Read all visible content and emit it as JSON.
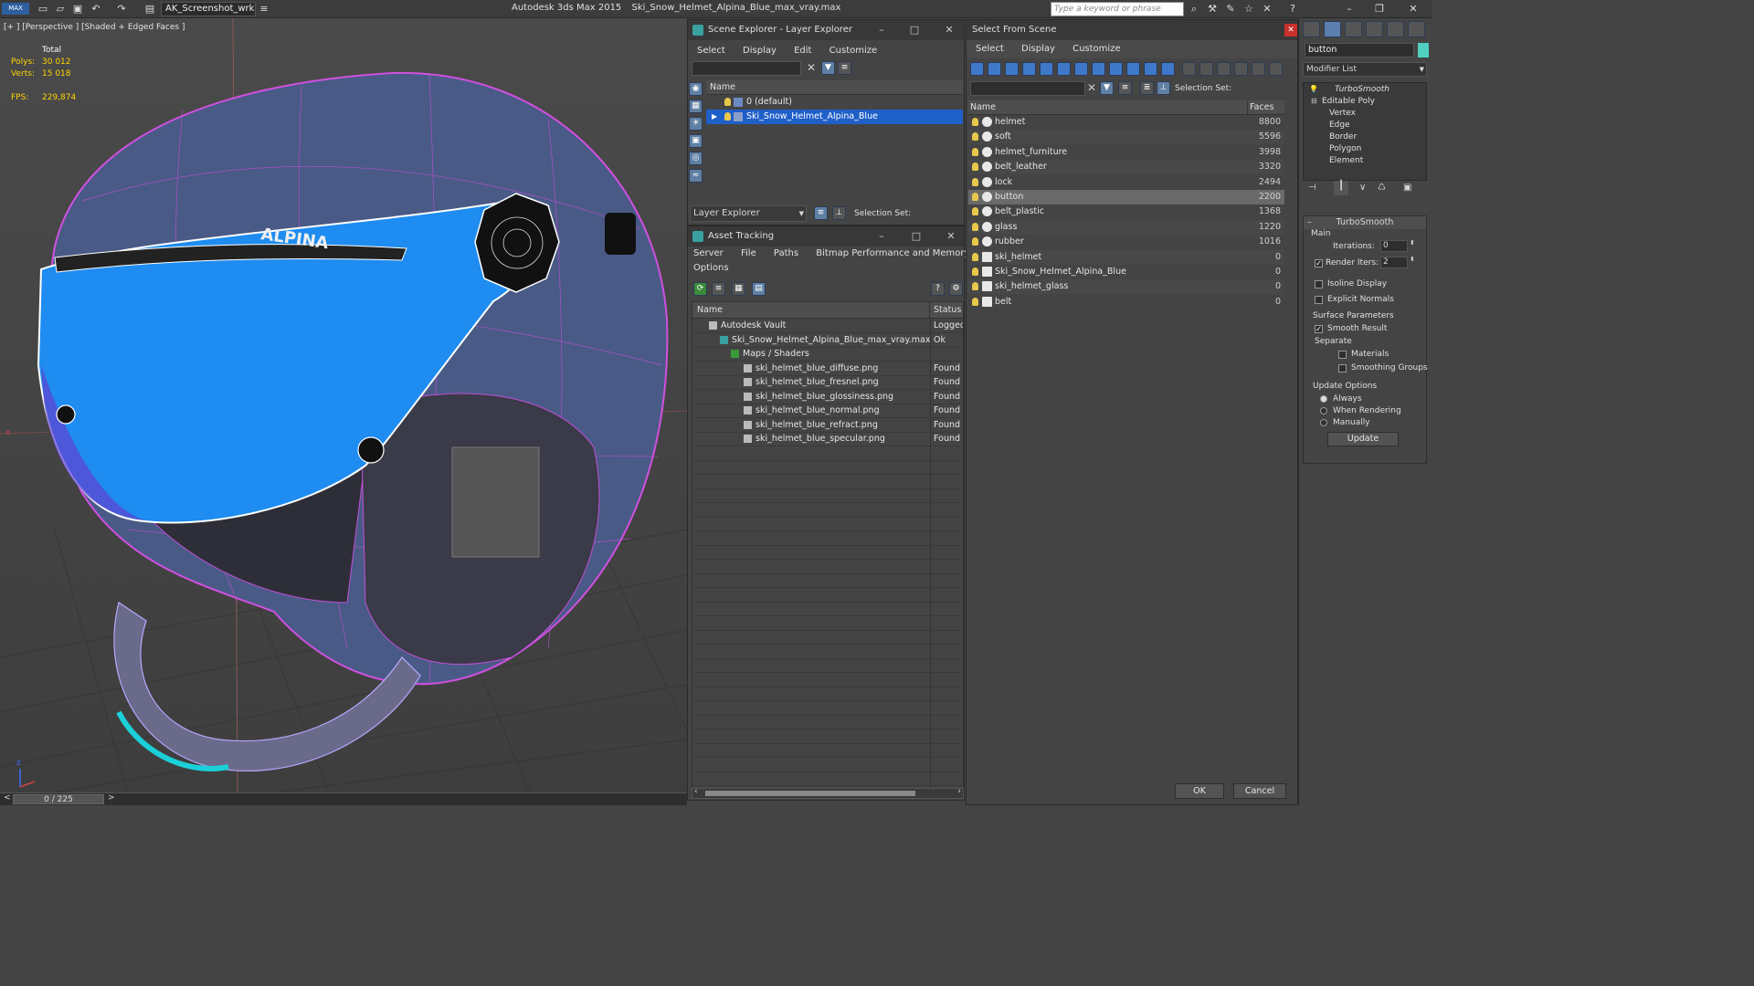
{
  "titlebar": {
    "app_badge": "MAX",
    "workspace": "AK_Screenshot_wrksp",
    "app_name": "Autodesk 3ds Max  2015",
    "file_name": "Ski_Snow_Helmet_Alpina_Blue_max_vray.max",
    "search_placeholder": "Type a keyword or phrase",
    "icons": [
      "new-icon",
      "open-icon",
      "save-icon",
      "undo-icon",
      "redo-icon",
      "project-icon",
      "binoculars-icon",
      "tools-icon",
      "wrench-icon",
      "star-icon",
      "close-icon",
      "help-icon"
    ]
  },
  "viewport": {
    "label": "[+ ] [Perspective ] [Shaded + Edged Faces ]",
    "stats": {
      "total_label": "Total",
      "polys_label": "Polys:",
      "polys_value": "30 012",
      "verts_label": "Verts:",
      "verts_value": "15 018",
      "fps_label": "FPS:",
      "fps_value": "229,874"
    },
    "logo_text": "ALPINA",
    "axis_x": "x",
    "axis_z": "z"
  },
  "timeline": {
    "frame_counter": "0 / 225",
    "prev": "<",
    "next": ">"
  },
  "scene_explorer": {
    "title": "Scene Explorer - Layer Explorer",
    "menu": [
      "Select",
      "Display",
      "Edit",
      "Customize"
    ],
    "column_name": "Name",
    "layers": [
      "0 (default)",
      "Ski_Snow_Helmet_Alpina_Blue"
    ],
    "bottom_dropdown": "Layer Explorer",
    "selection_set_label": "Selection Set:"
  },
  "asset_tracking": {
    "title": "Asset Tracking",
    "menu_row1": [
      "Server",
      "File",
      "Paths",
      "Bitmap Performance and Memory"
    ],
    "menu_row2": [
      "Options"
    ],
    "columns": {
      "name": "Name",
      "status": "Status"
    },
    "rows": [
      {
        "name": "Autodesk Vault",
        "status": "Logged"
      },
      {
        "name": "Ski_Snow_Helmet_Alpina_Blue_max_vray.max",
        "status": "Ok"
      },
      {
        "name": "Maps / Shaders",
        "status": ""
      },
      {
        "name": "ski_helmet_blue_diffuse.png",
        "status": "Found"
      },
      {
        "name": "ski_helmet_blue_fresnel.png",
        "status": "Found"
      },
      {
        "name": "ski_helmet_blue_glossiness.png",
        "status": "Found"
      },
      {
        "name": "ski_helmet_blue_normal.png",
        "status": "Found"
      },
      {
        "name": "ski_helmet_blue_refract.png",
        "status": "Found"
      },
      {
        "name": "ski_helmet_blue_specular.png",
        "status": "Found"
      }
    ]
  },
  "select_from_scene": {
    "title": "Select From Scene",
    "menu": [
      "Select",
      "Display",
      "Customize"
    ],
    "selection_set_label": "Selection Set:",
    "columns": {
      "name": "Name",
      "faces": "Faces"
    },
    "rows": [
      {
        "name": "helmet",
        "faces": "8800"
      },
      {
        "name": "soft",
        "faces": "5596"
      },
      {
        "name": "helmet_furniture",
        "faces": "3998"
      },
      {
        "name": "belt_leather",
        "faces": "3320"
      },
      {
        "name": "lock",
        "faces": "2494"
      },
      {
        "name": "button",
        "faces": "2200"
      },
      {
        "name": "belt_plastic",
        "faces": "1368"
      },
      {
        "name": "glass",
        "faces": "1220"
      },
      {
        "name": "rubber",
        "faces": "1016"
      },
      {
        "name": "ski_helmet",
        "faces": "0"
      },
      {
        "name": "Ski_Snow_Helmet_Alpina_Blue",
        "faces": "0"
      },
      {
        "name": "ski_helmet_glass",
        "faces": "0"
      },
      {
        "name": "belt",
        "faces": "0"
      }
    ],
    "ok_label": "OK",
    "cancel_label": "Cancel"
  },
  "command_panel": {
    "object_name": "button",
    "modifier_list": "Modifier List",
    "stack": [
      "TurboSmooth",
      "Editable Poly",
      "Vertex",
      "Edge",
      "Border",
      "Polygon",
      "Element"
    ],
    "rollout_title": "TurboSmooth",
    "main_group": "Main",
    "iterations_label": "Iterations:",
    "iterations_value": "0",
    "render_iters_label": "Render Iters:",
    "render_iters_value": "2",
    "isoline_label": "Isoline Display",
    "explicit_normals_label": "Explicit Normals",
    "surface_group": "Surface Parameters",
    "smooth_result_label": "Smooth Result",
    "separate_label": "Separate",
    "materials_label": "Materials",
    "smoothing_groups_label": "Smoothing Groups",
    "update_group": "Update Options",
    "always_label": "Always",
    "when_rendering_label": "When Rendering",
    "manually_label": "Manually",
    "update_button": "Update",
    "check_mark": "✓"
  },
  "colors": {
    "selection_blue": "#1f5fc8",
    "wire_magenta": "#d050e0",
    "visor_blue": "#1e8cf0",
    "stat_yellow": "#ffd400"
  }
}
